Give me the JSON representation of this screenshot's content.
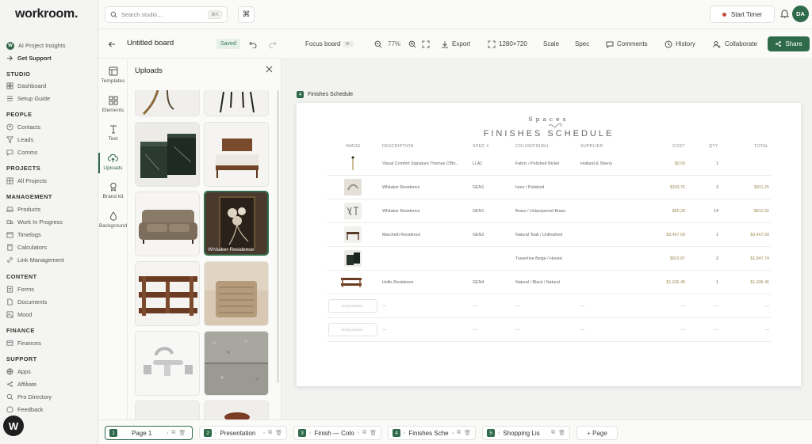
{
  "app": {
    "logo": "workroom."
  },
  "sidebar": {
    "top": [
      {
        "label": "AI Project Insights"
      },
      {
        "label": "Get Support"
      }
    ],
    "sections": [
      {
        "title": "STUDIO",
        "items": [
          "Dashboard",
          "Setup Guide"
        ]
      },
      {
        "title": "PEOPLE",
        "items": [
          "Contacts",
          "Leads",
          "Comms"
        ]
      },
      {
        "title": "PROJECTS",
        "items": [
          "All Projects"
        ]
      },
      {
        "title": "MANAGEMENT",
        "items": [
          "Products",
          "Work In Progress",
          "Timelogs",
          "Calculators",
          "Link Management"
        ]
      },
      {
        "title": "CONTENT",
        "items": [
          "Forms",
          "Documents",
          "Mood"
        ]
      },
      {
        "title": "FINANCE",
        "items": [
          "Finances"
        ]
      },
      {
        "title": "SUPPORT",
        "items": [
          "Apps",
          "Affiliate",
          "Pro Directory",
          "Feedback"
        ]
      }
    ],
    "fab": "W",
    "badge": "W"
  },
  "topbar": {
    "search_placeholder": "Search studio...",
    "search_kbd": "⌘K",
    "cmd_icon": "⌘",
    "timer_label": "Start Timer",
    "avatar": "DA"
  },
  "board": {
    "title": "Untitled board",
    "saved": "Saved",
    "focus": "Focus board",
    "focus_kbd": "⌘ .",
    "zoom": "77%",
    "export": "Export",
    "size": "1280×720",
    "scale": "Scale",
    "spec": "Spec",
    "comments": "Comments",
    "history": "History",
    "collaborate": "Collaborate",
    "share": "Share"
  },
  "rail": [
    {
      "label": "Templates"
    },
    {
      "label": "Elements"
    },
    {
      "label": "Text"
    },
    {
      "label": "Uploads"
    },
    {
      "label": "Brand kit"
    },
    {
      "label": "Background"
    }
  ],
  "uploads": {
    "title": "Uploads",
    "selected_label": "Whitaker Residence"
  },
  "canvas": {
    "page_num": "4",
    "page_name": "Finishes Schedule",
    "brand": "Spaces",
    "title": "FINISHES SCHEDULE",
    "columns": [
      "IMAGE",
      "DESCRIPTION",
      "SPEC #",
      "COLOR/FINISH",
      "SUPPLIER",
      "COST",
      "QTY",
      "TOTAL"
    ],
    "rows": [
      {
        "description": "Visual Comfort Signature Thomas O'Bri...",
        "spec": "LLA1",
        "finish": "Fabric / Polished Nickel",
        "supplier": "Holland & Sherry",
        "cost": "$0.00",
        "qty": "1",
        "total": ""
      },
      {
        "description": "Whitaker Residence",
        "spec": "GEN1",
        "finish": "Ivory / Polished",
        "supplier": "",
        "cost": "$303.75",
        "qty": "3",
        "total": "$911.25"
      },
      {
        "description": "Whitaker Residence",
        "spec": "GEN1",
        "finish": "Brass / Unlacquered Brass",
        "supplier": "",
        "cost": "$65.28",
        "qty": "14",
        "total": "$913.92"
      },
      {
        "description": "Marchetti Residence",
        "spec": "GEN2",
        "finish": "Natural Teak / Unfinished",
        "supplier": "",
        "cost": "$3,467.69",
        "qty": "1",
        "total": "$3,467.69"
      },
      {
        "description": "",
        "spec": "",
        "finish": "Travertine Beige / Honed",
        "supplier": "",
        "cost": "$923.87",
        "qty": "2",
        "total": "$1,847.74"
      },
      {
        "description": "Hollis Residence",
        "spec": "GEN4",
        "finish": "Natural / Black / Natural",
        "supplier": "",
        "cost": "$1,036.46",
        "qty": "1",
        "total": "$1,036.46"
      }
    ],
    "empty_rows": [
      {
        "drop": "Drop product",
        "dash": "—"
      },
      {
        "drop": "Drop product",
        "dash": "—"
      }
    ]
  },
  "pages": [
    {
      "num": "1",
      "name": "Page 1"
    },
    {
      "num": "2",
      "name": "Presentation"
    },
    {
      "num": "3",
      "name": "Finish — Colo"
    },
    {
      "num": "4",
      "name": "Finishes Sche"
    },
    {
      "num": "5",
      "name": "Shopping Lis"
    }
  ],
  "add_page": "+ Page",
  "colors": {
    "accent": "#2f6b4a",
    "timer_dot": "#c24a3a",
    "price": "#a08a55"
  }
}
